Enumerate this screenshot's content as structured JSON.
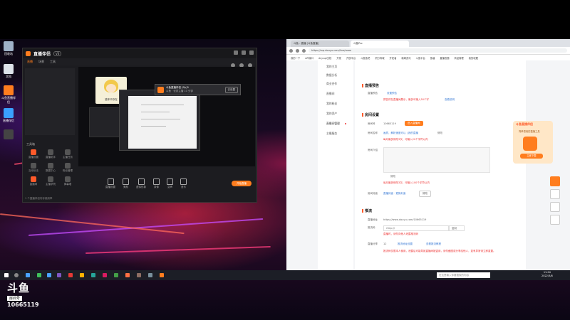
{
  "desktop": {
    "icons": [
      {
        "label": "回收站",
        "color": "#9fb3c8"
      },
      {
        "label": "文档",
        "color": "#dde3ea"
      },
      {
        "label": "斗鱼直播伴侣",
        "color": "#ff7d1e"
      },
      {
        "label": "直播伴侣",
        "color": "#3aa0ff"
      },
      {
        "label": "",
        "color": "#444"
      }
    ]
  },
  "studio": {
    "brand": "直播伴侣",
    "version": "V6",
    "tabs": [
      "直播",
      "场景",
      "工具"
    ],
    "tools_label": "工具箱",
    "tools": [
      "直播设置",
      "直播助手",
      "主播任务",
      "互动玩法",
      "数据中心",
      "粉丝管理",
      "直播间",
      "主播学院",
      "弹幕墙"
    ],
    "footer": "1 个直播伴侣内存使用率",
    "avatar_caption": "猫本不存在",
    "popup_title": "斗鱼直播伴侣 (Dy)5",
    "popup_sub": "斗鱼 · 优质主播  10 分钟",
    "popup_btn": "去设置",
    "bottom": [
      "直播设置",
      "美颜",
      "虚拟形象",
      "录像",
      "变声",
      "音乐"
    ],
    "live_btn": "开始直播"
  },
  "browser": {
    "tabs": [
      "斗鱼 - 直播 [斗鱼直播]",
      "斗鱼Pro"
    ],
    "address": "https://mp.douyu.com/live/room",
    "bookmarks": [
      "我的一下",
      "API接口",
      "dny.api文档",
      "开发",
      "开放平台",
      "斗鱼鱼吧",
      "积分商城",
      "开发者",
      "新闻资讯",
      "斗鱼平台",
      "鱼塘",
      "直播答题",
      "商品管理",
      "我的收藏"
    ],
    "sidebar": [
      "我的主页",
      "数据分析",
      "商业合作",
      "直播间",
      "我的粉丝",
      "我的资产",
      "直播间管理",
      "主播服务"
    ],
    "sec1": {
      "title": "直播预告",
      "label": "直播预告",
      "value": "设置预告",
      "hint": "预告将在直播间展示，最多可输入50个字",
      "link": "查看说明"
    },
    "sec2": {
      "title": "房间设置",
      "room_label": "房间号",
      "room_value": "10665119",
      "room_btn": "进入直播间",
      "name_label": "房间名称",
      "name_value": "画质，解析速度可以 | 我的直播",
      "name_edit": "修改",
      "name_hint": "每月最多修改3次，可输入20个字符以内",
      "intro_label": "房间介绍",
      "intro_edit": "修改",
      "intro_hint": "每月最多修改3次，可输入100个字符以内",
      "cover_label": "房间封面",
      "cover_link": "直播封面 · 更换封面",
      "cover_btn": "修改"
    },
    "sec3": {
      "title": "推流",
      "addr_label": "直播地址",
      "addr_value": "https://www.douyu.com/10665119",
      "code_label": "推流码",
      "code_value": "rtmp://",
      "code_btn": "复制",
      "code_hint": "直播时，请勿向他人泄露推流码",
      "share_label": "直播分享",
      "share_value": "12",
      "share_link1": "推流地址设置",
      "share_link2": "查看推流教程",
      "warn": "推流码仅限本人使用，泄露后可能导致直播间被盗用，请勿截图或分享给他人，如有异常请立即重置。"
    },
    "promo": {
      "title": "斗鱼直播伴侣",
      "sub": "简单易用的直播工具",
      "btn": "立即下载"
    }
  },
  "taskbar": {
    "search_placeholder": "在这里输入你要搜索的内容",
    "time": "11:04",
    "date": "2022/3/8",
    "icons": [
      "#4aa3ff",
      "#3fc15a",
      "#7e57c2",
      "#e53935",
      "#ffb300",
      "#26a69a",
      "#d81b60",
      "#43a047",
      "#ff7043",
      "#8d6e63",
      "#78909c"
    ]
  },
  "watermark": {
    "brand": "斗鱼",
    "room_label": "房间号",
    "room_number": "10665119"
  }
}
